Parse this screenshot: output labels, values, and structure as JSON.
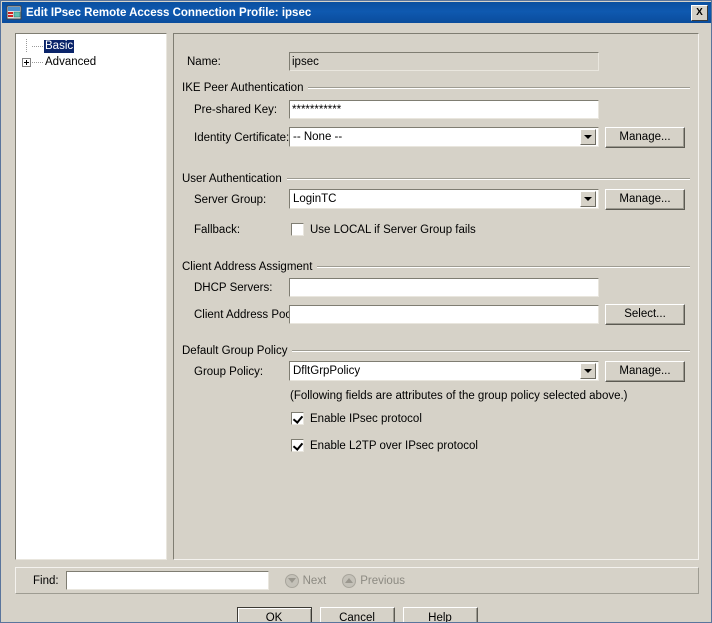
{
  "window": {
    "title": "Edit IPsec Remote Access Connection Profile: ipsec",
    "icon": "profile-window-icon",
    "close_label": "X"
  },
  "tree": {
    "items": [
      {
        "label": "Basic",
        "selected": true,
        "expandable": false
      },
      {
        "label": "Advanced",
        "selected": false,
        "expandable": true
      }
    ]
  },
  "form": {
    "name": {
      "label": "Name:",
      "value": "ipsec"
    },
    "ike_peer_authentication": {
      "title": "IKE Peer Authentication",
      "pre_shared_key": {
        "label": "Pre-shared Key:",
        "value": "***********"
      },
      "identity_certificate": {
        "label": "Identity Certificate:",
        "value": "-- None --",
        "manage_label": "Manage..."
      }
    },
    "user_authentication": {
      "title": "User Authentication",
      "server_group": {
        "label": "Server Group:",
        "value": "LoginTC",
        "manage_label": "Manage..."
      },
      "fallback": {
        "label": "Fallback:",
        "checkbox_label": "Use LOCAL if Server Group fails",
        "checked": false
      }
    },
    "client_address_assignment": {
      "title": "Client Address Assigment",
      "dhcp_servers": {
        "label": "DHCP Servers:",
        "value": ""
      },
      "client_address_pools": {
        "label": "Client Address Pools:",
        "value": "",
        "select_label": "Select..."
      }
    },
    "default_group_policy": {
      "title": "Default Group Policy",
      "group_policy": {
        "label": "Group Policy:",
        "value": "DfltGrpPolicy",
        "manage_label": "Manage..."
      },
      "note": "(Following fields are attributes of the group policy selected above.)",
      "enable_ipsec": {
        "label": "Enable IPsec protocol",
        "checked": true
      },
      "enable_l2tp": {
        "label": "Enable L2TP over IPsec protocol",
        "checked": true
      }
    }
  },
  "find": {
    "label": "Find:",
    "value": "",
    "next_label": "Next",
    "previous_label": "Previous"
  },
  "footer": {
    "ok_label": "OK",
    "cancel_label": "Cancel",
    "help_label": "Help"
  },
  "colors": {
    "titlebar": "#0f59b0",
    "face": "#d6d2c8",
    "selection": "#0a246a",
    "field": "#ffffff",
    "disabled_text": "#8c8a82"
  }
}
